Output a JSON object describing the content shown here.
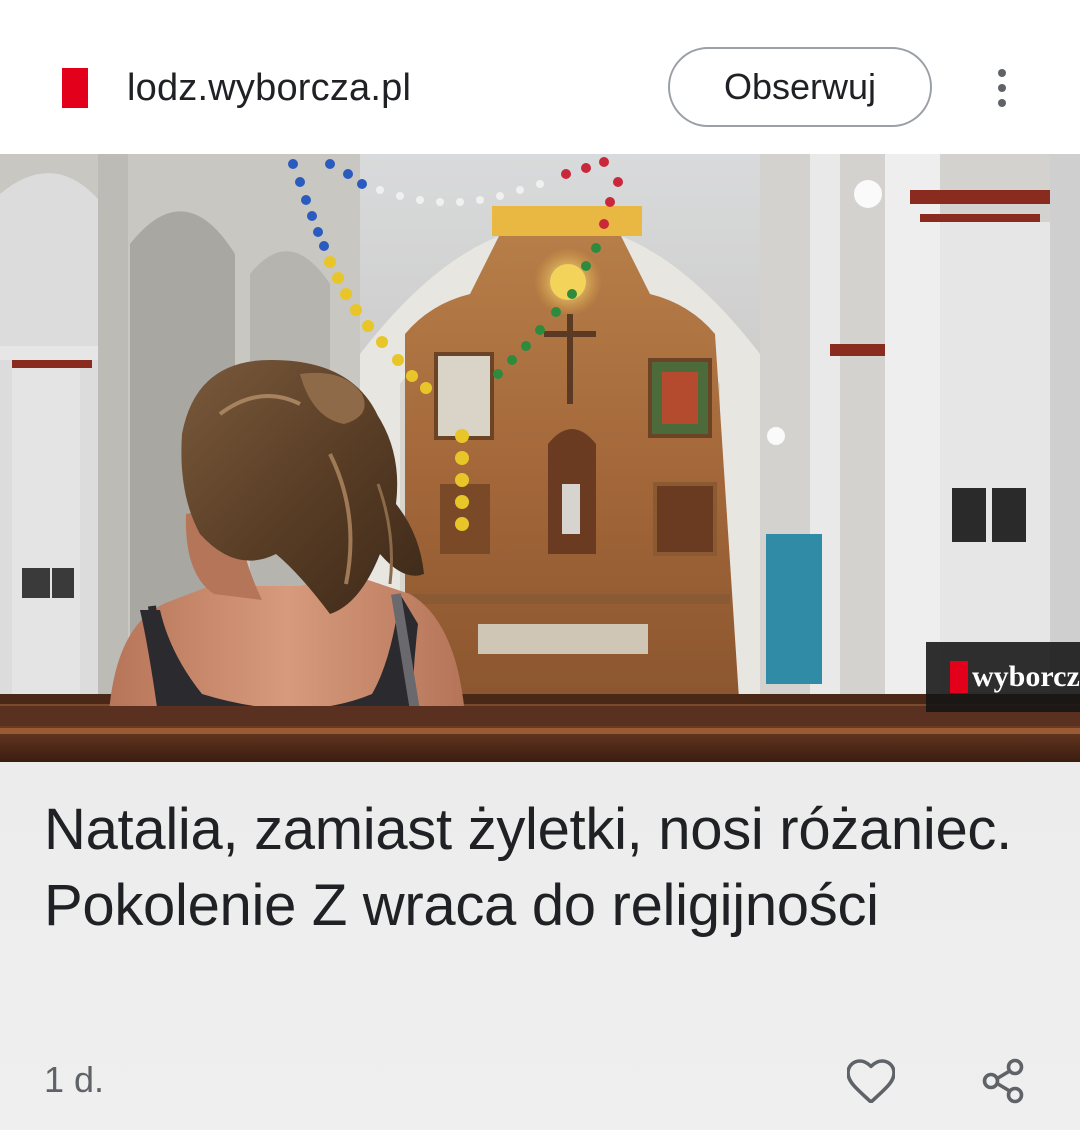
{
  "header": {
    "site_name": "lodz.wyborcza.pl",
    "follow_label": "Obserwuj",
    "brand_color": "#e3001b",
    "menu_icon": "more-vert-icon"
  },
  "hero": {
    "watermark_text": "wyborcz",
    "watermark_color": "#e3001b"
  },
  "article": {
    "headline": "Natalia, zamiast żyletki, nosi różaniec. Pokolenie Z wraca do religijności",
    "age": "1 d.",
    "like_icon": "heart-outline-icon",
    "share_icon": "share-icon"
  }
}
